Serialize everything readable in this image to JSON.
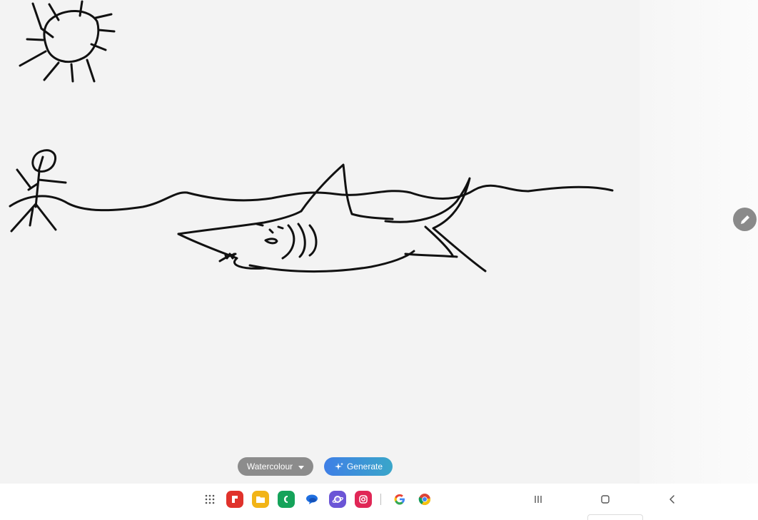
{
  "controls": {
    "style_label": "Watercolour",
    "generate_label": "Generate"
  },
  "taskbar": {
    "apps": [
      {
        "name": "app-drawer",
        "icon": "grid-icon"
      },
      {
        "name": "flipboard",
        "icon": "flipboard-icon",
        "color": "#e0322b"
      },
      {
        "name": "files",
        "icon": "folder-icon",
        "color": "#f2b417"
      },
      {
        "name": "phone",
        "icon": "phone-icon",
        "color": "#15a35a"
      },
      {
        "name": "messages",
        "icon": "chat-bubble-icon",
        "color": "#1f6fe0"
      },
      {
        "name": "internet",
        "icon": "planet-icon",
        "color": "#6b55d6"
      },
      {
        "name": "camera",
        "icon": "camera-icon",
        "color": "#e02756"
      },
      {
        "name": "google",
        "icon": "google-icon"
      },
      {
        "name": "chrome",
        "icon": "chrome-icon"
      }
    ],
    "nav": [
      {
        "name": "recents",
        "icon": "recents-icon"
      },
      {
        "name": "home",
        "icon": "home-icon"
      },
      {
        "name": "back",
        "icon": "back-icon"
      }
    ]
  },
  "colors": {
    "ink": "#111111",
    "fab": "#8a8a8a",
    "dropdown": "#8c8c8c",
    "generate_start": "#3f7fe6",
    "generate_end": "#3aa6c9"
  }
}
